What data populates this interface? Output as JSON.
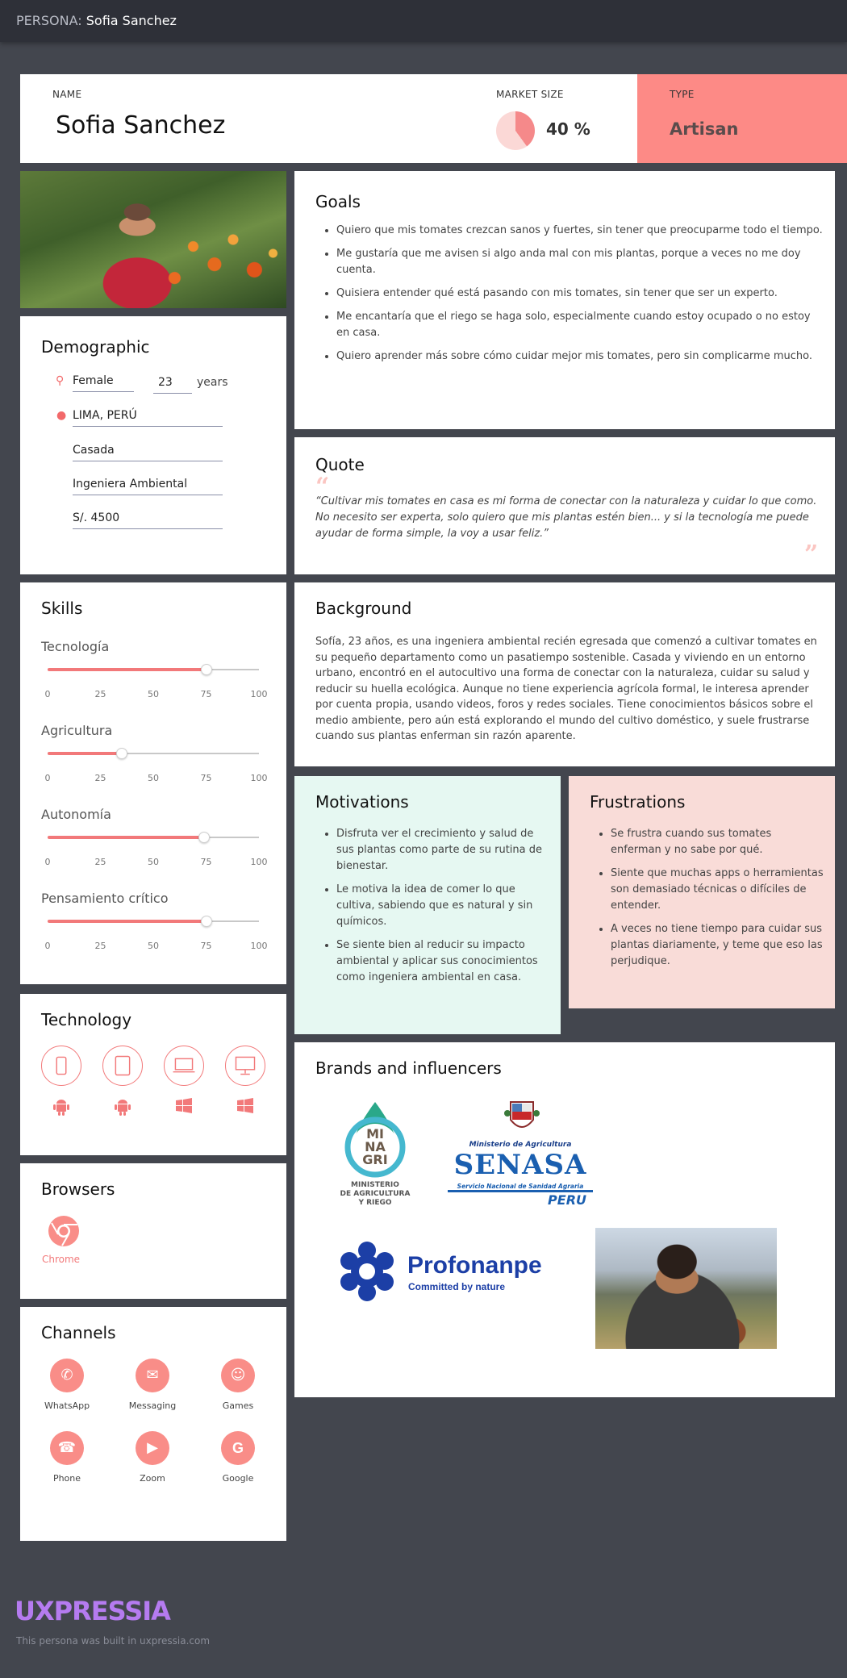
{
  "topbar": {
    "prefix": "PERSONA:",
    "name": "Sofia Sanchez"
  },
  "header": {
    "name_label": "NAME",
    "name": "Sofia Sanchez",
    "market_label": "MARKET SIZE",
    "market_value": "40 %",
    "market_fraction": 0.4,
    "type_label": "TYPE",
    "type_value": "Artisan",
    "type_color": "#fd8a86"
  },
  "demographic": {
    "title": "Demographic",
    "gender": "Female",
    "age": "23",
    "age_unit": "years",
    "location": "LIMA, PERÚ",
    "status": "Casada",
    "occupation": "Ingeniera Ambiental",
    "income": "S/. 4500"
  },
  "skills": {
    "title": "Skills",
    "ticks": [
      "0",
      "25",
      "50",
      "75",
      "100"
    ],
    "items": [
      {
        "label": "Tecnología",
        "value": 75
      },
      {
        "label": "Agricultura",
        "value": 35
      },
      {
        "label": "Autonomía",
        "value": 74
      },
      {
        "label": "Pensamiento crítico",
        "value": 75
      }
    ]
  },
  "technology": {
    "title": "Technology",
    "devices": [
      "phone-icon",
      "tablet-icon",
      "laptop-icon",
      "desktop-icon"
    ],
    "os": [
      "android-icon",
      "android-icon",
      "windows-icon",
      "windows-icon"
    ]
  },
  "browsers": {
    "title": "Browsers",
    "items": [
      {
        "label": "Chrome",
        "icon": "chrome-icon"
      }
    ]
  },
  "channels": {
    "title": "Channels",
    "items": [
      {
        "label": "WhatsApp",
        "icon": "whatsapp-icon"
      },
      {
        "label": "Messaging",
        "icon": "messaging-icon"
      },
      {
        "label": "Games",
        "icon": "games-icon"
      },
      {
        "label": "Phone",
        "icon": "phone-icon"
      },
      {
        "label": "Zoom",
        "icon": "zoom-icon"
      },
      {
        "label": "Google",
        "icon": "google-icon"
      }
    ]
  },
  "goals": {
    "title": "Goals",
    "items": [
      "Quiero que mis tomates crezcan sanos y fuertes, sin tener que preocuparme todo el tiempo.",
      "Me gustaría que me avisen si algo anda mal con mis plantas, porque a veces no me doy cuenta.",
      "Quisiera entender qué está pasando con mis tomates, sin tener que ser un experto.",
      "Me encantaría que el riego se haga solo, especialmente cuando estoy ocupado o no estoy en casa.",
      "Quiero aprender más sobre cómo cuidar mejor mis tomates, pero sin complicarme mucho."
    ]
  },
  "quote": {
    "title": "Quote",
    "text": "“Cultivar mis tomates en casa es mi forma de conectar con la naturaleza y cuidar lo que como. No necesito ser experta, solo quiero que mis plantas estén bien... y si la tecnología me puede ayudar de forma simple, la voy a usar feliz.”"
  },
  "background": {
    "title": "Background",
    "text": "Sofía, 23 años, es una ingeniera ambiental recién egresada que comenzó a cultivar tomates en su pequeño departamento como un pasatiempo sostenible. Casada y viviendo en un entorno urbano, encontró en el autocultivo una forma de conectar con la naturaleza, cuidar su salud y reducir su huella ecológica. Aunque no tiene experiencia agrícola formal, le interesa aprender por cuenta propia, usando videos, foros y redes sociales. Tiene conocimientos básicos sobre el medio ambiente, pero aún está explorando el mundo del cultivo doméstico, y suele frustrarse cuando sus plantas enferman sin razón aparente."
  },
  "motivations": {
    "title": "Motivations",
    "items": [
      "Disfruta ver el crecimiento y salud de sus plantas como parte de su rutina de bienestar.",
      "Le motiva la idea de comer lo que cultiva, sabiendo que es natural y sin químicos.",
      "Se siente bien al reducir su impacto ambiental y aplicar sus conocimientos como ingeniera ambiental en casa."
    ],
    "color": "#e6f8f2"
  },
  "frustrations": {
    "title": "Frustrations",
    "items": [
      "Se frustra cuando sus tomates enferman y no sabe por qué.",
      "Siente que muchas apps o herramientas son demasiado técnicas o difíciles de entender.",
      "A veces no tiene tiempo para cuidar sus plantas diariamente, y teme que eso las perjudique."
    ],
    "color": "#f9dcd8"
  },
  "brands": {
    "title": "Brands and influencers",
    "minagri": {
      "l1": "MI",
      "l2": "NA",
      "l3": "GRI",
      "sub1": "MINISTERIO",
      "sub2": "DE AGRICULTURA",
      "sub3": "Y RIEGO"
    },
    "senasa": {
      "top": "Ministerio de Agricultura",
      "name": "SENASA",
      "sub": "Servicio Nacional de Sanidad Agraria",
      "country": "PERU"
    },
    "profonanpe": {
      "name": "Profonanpe",
      "tagline": "Committed by nature"
    }
  },
  "footer": {
    "logo": "UXPRESSIA",
    "note": "This persona was built in uxpressia.com"
  }
}
